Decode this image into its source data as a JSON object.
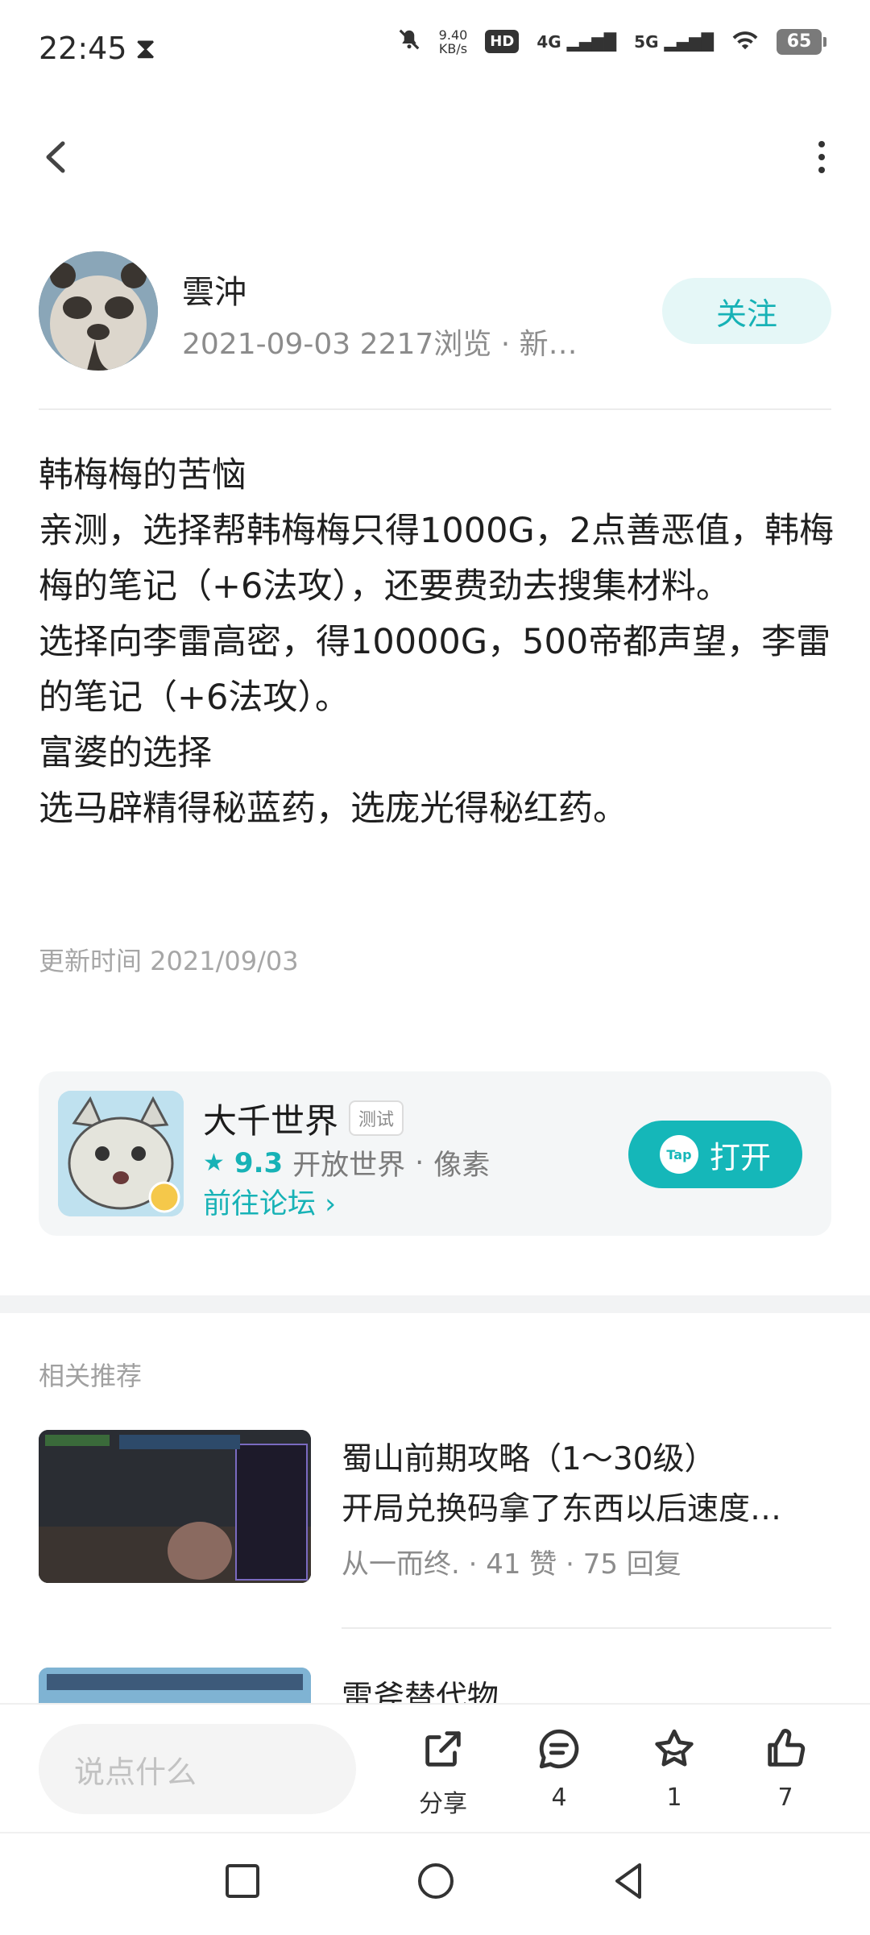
{
  "status_bar": {
    "time": "22:45",
    "net_speed_value": "9.40",
    "net_speed_unit": "KB/s",
    "hd": "HD",
    "net1": "4G",
    "net2": "5G",
    "battery": "65"
  },
  "author": {
    "name": "雲沖",
    "meta": "2021-09-03  2217浏览  ·  新…",
    "follow_label": "关注"
  },
  "post": {
    "lines": [
      "韩梅梅的苦恼",
      "亲测，选择帮韩梅梅只得1000G，2点善恶值，韩梅梅的笔记（+6法攻），还要费劲去搜集材料。",
      "选择向李雷高密，得10000G，500帝都声望，李雷的笔记（+6法攻）。",
      "富婆的选择",
      "选马辟精得秘蓝药，选庞光得秘红药。"
    ],
    "update_time": "更新时间 2021/09/03"
  },
  "app_card": {
    "name": "大千世界",
    "tag": "测试",
    "rating": "9.3",
    "genre1": "开放世界",
    "sep": "·",
    "genre2": "像素",
    "forum_link": "前往论坛 ›",
    "open_label": "打开",
    "tap_logo": "Tap"
  },
  "related": {
    "title": "相关推荐",
    "items": [
      {
        "title": "蜀山前期攻略（1～30级）",
        "subtitle": "开局兑换码拿了东西以后速度…",
        "meta": "从一而终.  ·  41 赞  ·  75 回复"
      },
      {
        "title": "雷斧替代物"
      }
    ]
  },
  "action_bar": {
    "input_placeholder": "说点什么",
    "share_label": "分享",
    "comment_count": "4",
    "fav_count": "1",
    "like_count": "7"
  }
}
